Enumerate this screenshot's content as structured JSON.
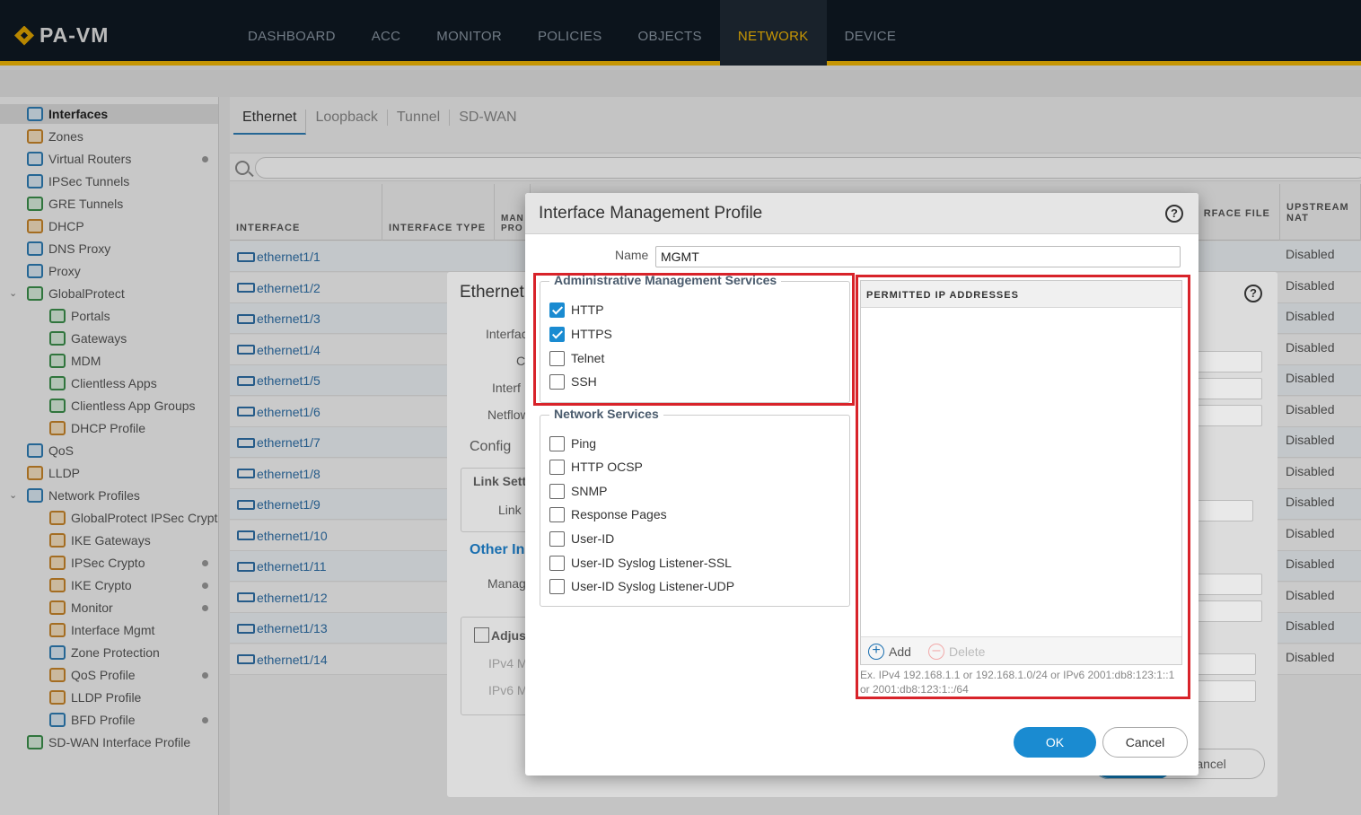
{
  "app": {
    "logo": "PA-VM"
  },
  "nav": {
    "tabs": [
      "DASHBOARD",
      "ACC",
      "MONITOR",
      "POLICIES",
      "OBJECTS",
      "NETWORK",
      "DEVICE"
    ],
    "active": "NETWORK"
  },
  "sidebar": {
    "items": [
      "Interfaces",
      "Zones",
      "Virtual Routers",
      "IPSec Tunnels",
      "GRE Tunnels",
      "DHCP",
      "DNS Proxy",
      "Proxy",
      "GlobalProtect",
      "Portals",
      "Gateways",
      "MDM",
      "Clientless Apps",
      "Clientless App Groups",
      "DHCP Profile",
      "QoS",
      "LLDP",
      "Network Profiles",
      "GlobalProtect IPSec Crypto",
      "IKE Gateways",
      "IPSec Crypto",
      "IKE Crypto",
      "Monitor",
      "Interface Mgmt",
      "Zone Protection",
      "QoS Profile",
      "LLDP Profile",
      "BFD Profile",
      "SD-WAN Interface Profile"
    ]
  },
  "subtabs": [
    "Ethernet",
    "Loopback",
    "Tunnel",
    "SD-WAN"
  ],
  "table": {
    "headers": {
      "interface": "INTERFACE",
      "type": "INTERFACE TYPE",
      "mgmt": "MAN PRO",
      "sdwan": "WAN RFACE FILE",
      "nat": "UPSTREAM NAT"
    },
    "rows": [
      "ethernet1/1",
      "ethernet1/2",
      "ethernet1/3",
      "ethernet1/4",
      "ethernet1/5",
      "ethernet1/6",
      "ethernet1/7",
      "ethernet1/8",
      "ethernet1/9",
      "ethernet1/10",
      "ethernet1/11",
      "ethernet1/12",
      "ethernet1/13",
      "ethernet1/14"
    ],
    "nat_value": "Disabled"
  },
  "bg_dialog": {
    "title": "Ethernet",
    "labels": {
      "interface": "Interfac",
      "c": "C",
      "interf": "Interf",
      "netflow": "Netflow",
      "config": "Config",
      "link": "Link Setti",
      "link2": "Link",
      "other": "Other In",
      "manag": "Manag",
      "adjust": "Adjust",
      "ipv4": "IPv4 M",
      "ipv6": "IPv6 M"
    },
    "cancel": "Cancel"
  },
  "dialog": {
    "title": "Interface Management Profile",
    "help": "?",
    "name_label": "Name",
    "name_value": "MGMT",
    "admin_legend": "Administrative Management Services",
    "admin_items": [
      {
        "label": "HTTP",
        "checked": true
      },
      {
        "label": "HTTPS",
        "checked": true
      },
      {
        "label": "Telnet",
        "checked": false
      },
      {
        "label": "SSH",
        "checked": false
      }
    ],
    "net_legend": "Network Services",
    "net_items": [
      {
        "label": "Ping",
        "checked": false
      },
      {
        "label": "HTTP OCSP",
        "checked": false
      },
      {
        "label": "SNMP",
        "checked": false
      },
      {
        "label": "Response Pages",
        "checked": false
      },
      {
        "label": "User-ID",
        "checked": false
      },
      {
        "label": "User-ID Syslog Listener-SSL",
        "checked": false
      },
      {
        "label": "User-ID Syslog Listener-UDP",
        "checked": false
      }
    ],
    "permitted_header": "PERMITTED IP ADDRESSES",
    "add": "Add",
    "delete": "Delete",
    "hint": "Ex. IPv4 192.168.1.1 or 192.168.1.0/24 or IPv6 2001:db8:123:1::1 or 2001:db8:123:1::/64",
    "ok": "OK",
    "cancel": "Cancel"
  },
  "colors": {
    "accent": "#1a8bd1",
    "highlight": "#d8232a",
    "nav_active": "#f2b705"
  }
}
